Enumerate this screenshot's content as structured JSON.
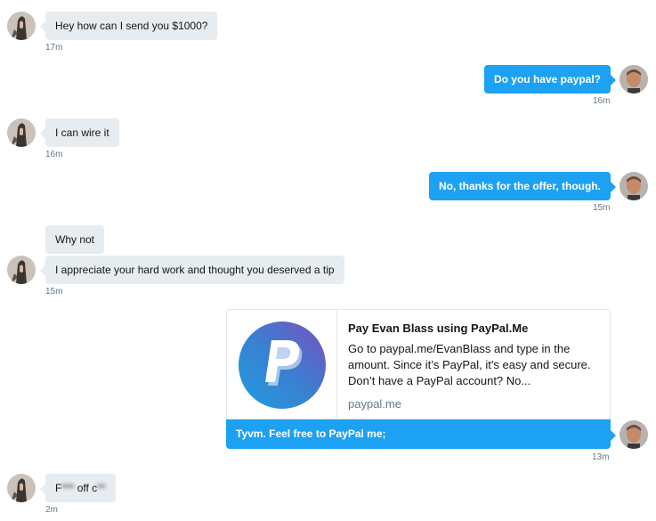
{
  "messages": [
    {
      "text": "Hey how can I send you $1000?",
      "time": "17m"
    },
    {
      "text": "Do you have paypal?",
      "time": "16m"
    },
    {
      "text": "I can wire it",
      "time": "16m"
    },
    {
      "text": "No, thanks for the offer, though.",
      "time": "15m"
    },
    {
      "text": "Why not"
    },
    {
      "text": "I appreciate your hard work and thought you deserved a tip",
      "time": "15m"
    },
    {
      "text": "Tyvm. Feel free to PayPal me;",
      "time": "13m"
    },
    {
      "text_visible_a": "F",
      "text_visible_b": "off c",
      "time": "2m"
    }
  ],
  "card": {
    "title": "Pay Evan Blass using PayPal.Me",
    "description": "Go to paypal.me/EvanBlass and type in the amount. Since it’s PayPal, it's easy and secure. Don’t have a PayPal account? No...",
    "domain": "paypal.me",
    "logo_icon": "paypal-logo-icon"
  },
  "colors": {
    "outgoing_bubble": "#1da1f2",
    "incoming_bubble": "#e6ecf0",
    "timestamp": "#657786"
  }
}
